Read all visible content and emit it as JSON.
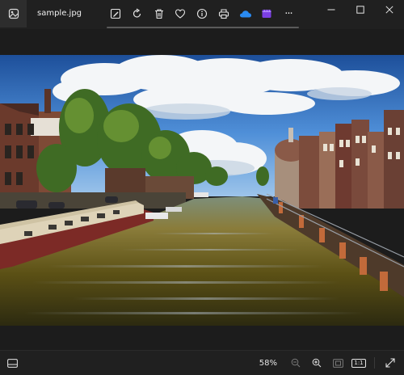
{
  "title": {
    "filename": "sample.jpg"
  },
  "toolbar": {
    "items": [
      {
        "icon": "edit-icon"
      },
      {
        "icon": "rotate-icon"
      },
      {
        "icon": "delete-icon"
      },
      {
        "icon": "favorite-icon"
      },
      {
        "icon": "info-icon"
      },
      {
        "icon": "print-icon"
      },
      {
        "icon": "onedrive-icon"
      },
      {
        "icon": "clipchamp-icon"
      },
      {
        "icon": "more-icon",
        "label": "···"
      }
    ]
  },
  "statusbar": {
    "zoom": "58%",
    "actual_size_label": "1:1"
  },
  "colors": {
    "background": "#1c1c1c",
    "chrome": "#202020",
    "onedrive": "#2a8bf2",
    "clipchamp": "#7b3fe4"
  }
}
